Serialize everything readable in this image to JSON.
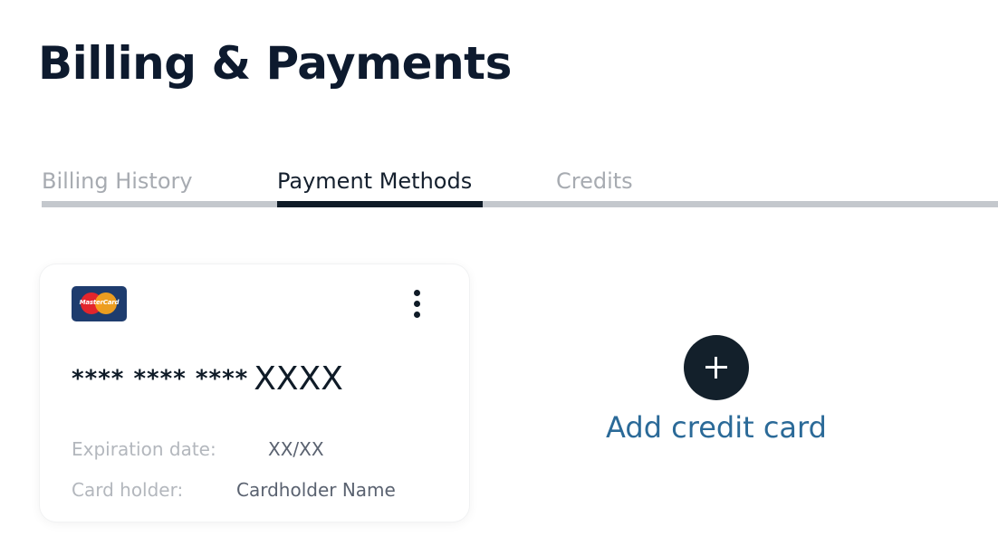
{
  "header": {
    "title": "Billing & Payments"
  },
  "tabs": [
    {
      "label": "Billing History",
      "active": false
    },
    {
      "label": "Payment Methods",
      "active": true
    },
    {
      "label": "Credits",
      "active": false
    }
  ],
  "card": {
    "brand_logo_text": "MasterCard",
    "brand_icon": "mastercard-logo",
    "menu_icon": "kebab-menu-icon",
    "number_mask": "**** **** ****",
    "number_last4": "XXXX",
    "expiration_label": "Expiration date:",
    "expiration_value": "XX/XX",
    "holder_label": "Card holder:",
    "holder_value": "Cardholder Name"
  },
  "add_card": {
    "icon": "plus-icon",
    "label": "Add credit card"
  },
  "colors": {
    "title": "#0d1a2e",
    "tab_active": "#15202e",
    "tab_inactive": "#a7abb1",
    "accent_link": "#2b6a98",
    "plus_button": "#13202b"
  }
}
